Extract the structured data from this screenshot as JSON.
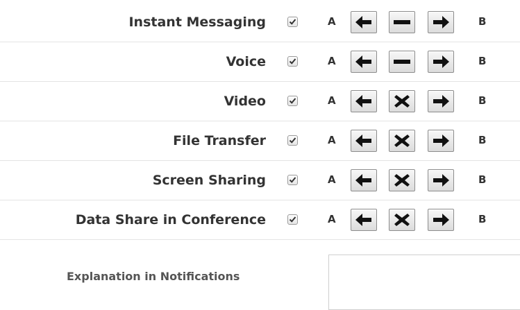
{
  "permissions": [
    {
      "label": "Instant Messaging",
      "checked": true,
      "side_a": "A",
      "side_b": "B",
      "mode": "bidirectional"
    },
    {
      "label": "Voice",
      "checked": true,
      "side_a": "A",
      "side_b": "B",
      "mode": "bidirectional"
    },
    {
      "label": "Video",
      "checked": true,
      "side_a": "A",
      "side_b": "B",
      "mode": "blocked"
    },
    {
      "label": "File Transfer",
      "checked": true,
      "side_a": "A",
      "side_b": "B",
      "mode": "blocked"
    },
    {
      "label": "Screen Sharing",
      "checked": true,
      "side_a": "A",
      "side_b": "B",
      "mode": "blocked"
    },
    {
      "label": "Data Share in Conference",
      "checked": true,
      "side_a": "A",
      "side_b": "B",
      "mode": "blocked"
    }
  ],
  "notifications": {
    "label": "Explanation in Notifications",
    "value": ""
  },
  "icons": {
    "left": "arrow-left-icon",
    "right": "arrow-right-icon",
    "allow": "dash-icon",
    "block": "x-icon"
  }
}
